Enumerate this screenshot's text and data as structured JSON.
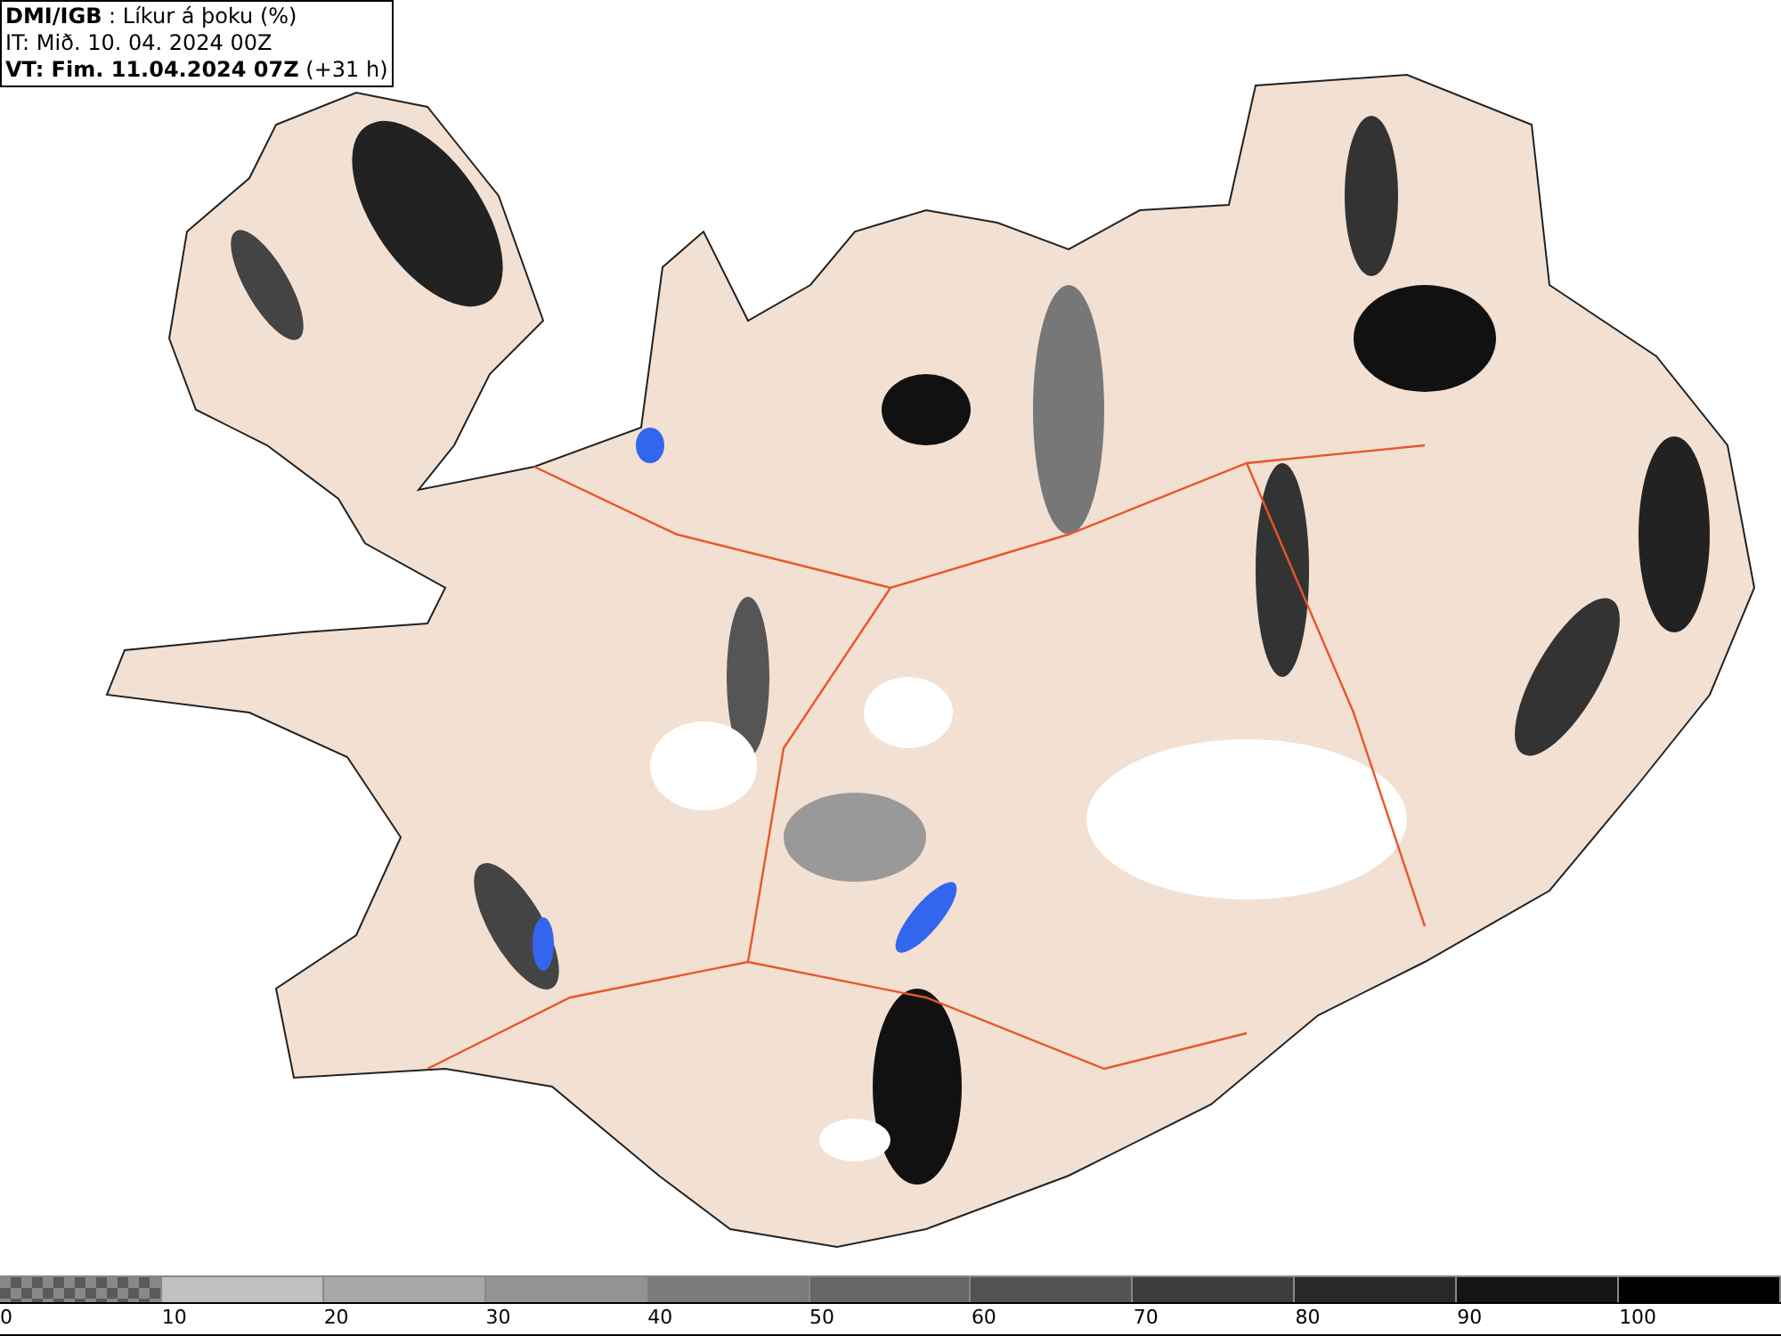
{
  "header": {
    "lines": [
      "**DMI/IGB** : Líkur á þoku (%)",
      "IT: Mið. 10. 04. 2024 00Z",
      "**VT: Fim. 11.04.2024 07Z** (+31 h)"
    ]
  },
  "colorbar": {
    "bins": [
      {
        "kind": "checker",
        "color": "#5a5a5a"
      },
      {
        "kind": "solid",
        "color": "#c0c0c0"
      },
      {
        "kind": "solid",
        "color": "#a8a8a8"
      },
      {
        "kind": "solid",
        "color": "#939393"
      },
      {
        "kind": "solid",
        "color": "#7b7b7b"
      },
      {
        "kind": "solid",
        "color": "#666666"
      },
      {
        "kind": "solid",
        "color": "#525252"
      },
      {
        "kind": "solid",
        "color": "#3d3d3d"
      },
      {
        "kind": "solid",
        "color": "#282828"
      },
      {
        "kind": "solid",
        "color": "#141414"
      },
      {
        "kind": "solid",
        "color": "#000000"
      }
    ],
    "ticks": [
      "0",
      "10",
      "20",
      "30",
      "40",
      "50",
      "60",
      "70",
      "80",
      "90",
      "100"
    ]
  }
}
